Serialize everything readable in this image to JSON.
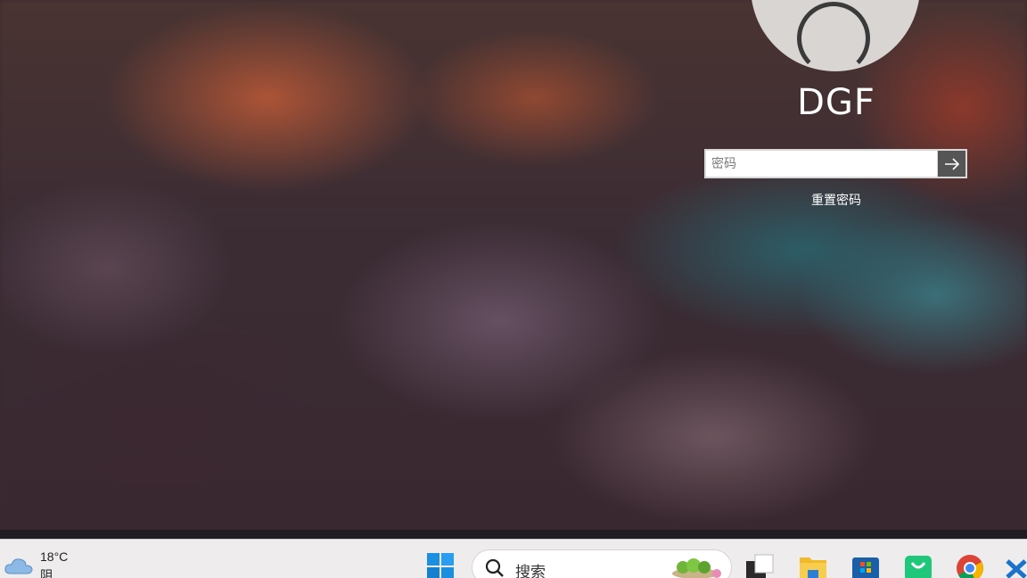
{
  "lock_screen": {
    "username": "DGF",
    "password_placeholder": "密码",
    "submit_icon": "arrow-right-icon",
    "reset_password_label": "重置密码"
  },
  "taskbar": {
    "weather": {
      "temperature": "18°C",
      "condition": "阴",
      "icon": "cloud-icon"
    },
    "search": {
      "label": "搜索"
    },
    "apps": [
      {
        "name": "start",
        "icon": "windows-logo-icon"
      },
      {
        "name": "task-view",
        "icon": "task-view-icon"
      },
      {
        "name": "file-explorer",
        "icon": "folder-icon"
      },
      {
        "name": "microsoft-store",
        "icon": "store-icon"
      },
      {
        "name": "shopping-app",
        "icon": "shopping-bag-icon"
      },
      {
        "name": "chrome",
        "icon": "chrome-icon"
      },
      {
        "name": "vscode",
        "icon": "vscode-icon"
      }
    ]
  },
  "colors": {
    "accent_blue": "#0a74da",
    "taskbar_bg": "#eeecec",
    "submit_button": "#555555"
  }
}
